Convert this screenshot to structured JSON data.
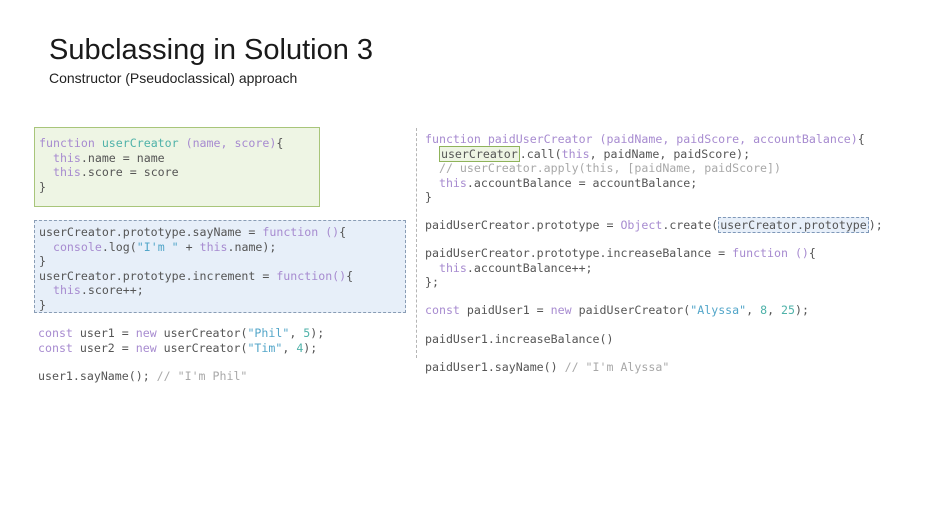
{
  "slide": {
    "title": "Subclassing in Solution 3",
    "subtitle": "Constructor (Pseudoclassical) approach"
  },
  "left_code": {
    "box1": {
      "l1_kw": "function",
      "l1_fn": "userCreator",
      "l1_params": "(name, score)",
      "l1_brace": "{",
      "l2_this": "this",
      "l2_rest": ".name = name",
      "l3_this": "this",
      "l3_rest": ".score = score",
      "l4": "}"
    },
    "box2": {
      "l1_a": "userCreator.prototype.sayName = ",
      "l1_kw": "function",
      "l1_paren": " ()",
      "l1_brace": "{",
      "l2_console": "console",
      "l2_a": ".log(",
      "l2_str": "\"I'm \"",
      "l2_b": " + ",
      "l2_this": "this",
      "l2_c": ".name);",
      "l3": "}",
      "l4_a": "userCreator.prototype.increment = ",
      "l4_kw": "function",
      "l4_paren": "()",
      "l4_brace": "{",
      "l5_this": "this",
      "l5_rest": ".score++;",
      "l6": "}"
    },
    "users": {
      "u1_kw": "const",
      "u1_a": " user1 = ",
      "u1_new": "new",
      "u1_b": " userCreator(",
      "u1_str": "\"Phil\"",
      "u1_c": ", ",
      "u1_num": "5",
      "u1_d": ");",
      "u2_kw": "const",
      "u2_a": " user2 = ",
      "u2_new": "new",
      "u2_b": " userCreator(",
      "u2_str": "\"Tim\"",
      "u2_c": ", ",
      "u2_num": "4",
      "u2_d": ");"
    },
    "call": {
      "code": "user1.sayName(); ",
      "comment": "// \"I'm Phil\""
    }
  },
  "right_code": {
    "r1_kw": "function",
    "r1_fn": " paidUserCreator",
    "r1_params": " (paidName, paidScore, accountBalance)",
    "r1_brace": "{",
    "r2_hl": "userCreator",
    "r2_a": ".call(",
    "r2_this": "this",
    "r2_b": ", paidName, paidScore);",
    "r3_comment": "// userCreator.apply(this, [paidName, paidScore])",
    "r4_this": "this",
    "r4_rest": ".accountBalance = accountBalance;",
    "r5": "}",
    "r6_a": "paidUserCreator.prototype = ",
    "r6_obj": "Object",
    "r6_b": ".create(",
    "r6_hl": "userCreator.prototype",
    "r6_c": ");",
    "r7_a": "paidUserCreator.prototype.increaseBalance = ",
    "r7_kw": "function",
    "r7_paren": " ()",
    "r7_brace": "{",
    "r8_this": "this",
    "r8_rest": ".accountBalance++;",
    "r9": "};",
    "r10_kw": "const",
    "r10_a": " paidUser1 = ",
    "r10_new": "new",
    "r10_b": " paidUserCreator(",
    "r10_str": "\"Alyssa\"",
    "r10_c": ", ",
    "r10_num1": "8",
    "r10_d": ", ",
    "r10_num2": "25",
    "r10_e": ");",
    "r11": "paidUser1.increaseBalance()",
    "r12_code": "paidUser1.sayName() ",
    "r12_comment": "// \"I'm Alyssa\""
  }
}
